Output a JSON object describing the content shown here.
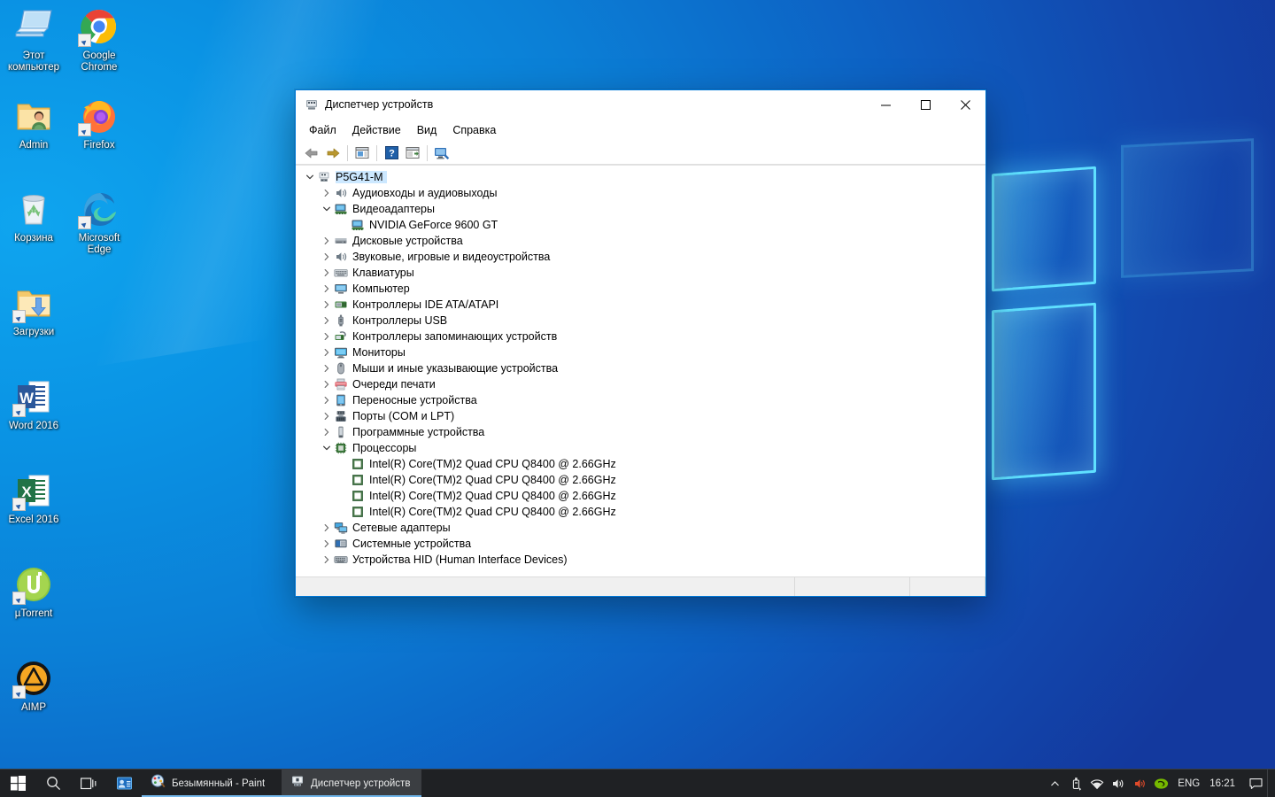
{
  "desktop": {
    "icons": [
      {
        "label": "Этот компьютер",
        "icon": "this-pc-icon",
        "shortcut": false
      },
      {
        "label": "Google Chrome",
        "icon": "chrome-icon",
        "shortcut": true
      },
      {
        "label": "Admin",
        "icon": "user-folder-icon",
        "shortcut": false
      },
      {
        "label": "Firefox",
        "icon": "firefox-icon",
        "shortcut": true
      },
      {
        "label": "Корзина",
        "icon": "recycle-bin-icon",
        "shortcut": false
      },
      {
        "label": "Microsoft Edge",
        "icon": "edge-icon",
        "shortcut": true
      },
      {
        "label": "Загрузки",
        "icon": "downloads-folder-icon",
        "shortcut": true
      },
      {
        "label": "Word 2016",
        "icon": "word-icon",
        "shortcut": true
      },
      {
        "label": "Excel 2016",
        "icon": "excel-icon",
        "shortcut": true
      },
      {
        "label": "µTorrent",
        "icon": "utorrent-icon",
        "shortcut": true
      },
      {
        "label": "AIMP",
        "icon": "aimp-icon",
        "shortcut": true
      }
    ]
  },
  "window": {
    "title": "Диспетчер устройств",
    "title_icon": "device-manager-icon",
    "controls": {
      "minimize": "—",
      "maximize": "☐",
      "close": "✕"
    },
    "menu": [
      {
        "label": "Файл",
        "name": "menu-file"
      },
      {
        "label": "Действие",
        "name": "menu-action"
      },
      {
        "label": "Вид",
        "name": "menu-view"
      },
      {
        "label": "Справка",
        "name": "menu-help"
      }
    ],
    "toolbar": [
      {
        "name": "back-arrow-icon",
        "kind": "back"
      },
      {
        "name": "forward-arrow-icon",
        "kind": "forward"
      },
      {
        "name": "separator",
        "kind": "sep"
      },
      {
        "name": "properties-icon",
        "kind": "props"
      },
      {
        "name": "separator",
        "kind": "sep"
      },
      {
        "name": "help-icon",
        "kind": "help"
      },
      {
        "name": "update-driver-icon",
        "kind": "update"
      },
      {
        "name": "separator",
        "kind": "sep"
      },
      {
        "name": "scan-hardware-icon",
        "kind": "scan"
      }
    ],
    "status": {
      "panel1": "",
      "panel2": "",
      "panel3": ""
    }
  },
  "tree": {
    "root": {
      "label": "P5G41-M",
      "icon": "computer-node-icon",
      "expanded": true,
      "selected": true
    },
    "nodes": [
      {
        "label": "Аудиовходы и аудиовыходы",
        "icon": "audio-icon",
        "expanded": false,
        "depth": 1
      },
      {
        "label": "Видеоадаптеры",
        "icon": "display-adapter-icon",
        "expanded": true,
        "depth": 1
      },
      {
        "label": "NVIDIA GeForce 9600 GT",
        "icon": "display-adapter-icon",
        "leaf": true,
        "depth": 2
      },
      {
        "label": "Дисковые устройства",
        "icon": "disk-drive-icon",
        "expanded": false,
        "depth": 1
      },
      {
        "label": "Звуковые, игровые и видеоустройства",
        "icon": "audio-icon",
        "expanded": false,
        "depth": 1
      },
      {
        "label": "Клавиатуры",
        "icon": "keyboard-icon",
        "expanded": false,
        "depth": 1
      },
      {
        "label": "Компьютер",
        "icon": "computer-icon",
        "expanded": false,
        "depth": 1
      },
      {
        "label": "Контроллеры IDE ATA/ATAPI",
        "icon": "ide-controller-icon",
        "expanded": false,
        "depth": 1
      },
      {
        "label": "Контроллеры USB",
        "icon": "usb-icon",
        "expanded": false,
        "depth": 1
      },
      {
        "label": "Контроллеры запоминающих устройств",
        "icon": "storage-controller-icon",
        "expanded": false,
        "depth": 1
      },
      {
        "label": "Мониторы",
        "icon": "monitor-icon",
        "expanded": false,
        "depth": 1
      },
      {
        "label": "Мыши и иные указывающие устройства",
        "icon": "mouse-icon",
        "expanded": false,
        "depth": 1
      },
      {
        "label": "Очереди печати",
        "icon": "printer-icon",
        "expanded": false,
        "depth": 1
      },
      {
        "label": "Переносные устройства",
        "icon": "portable-device-icon",
        "expanded": false,
        "depth": 1
      },
      {
        "label": "Порты (COM и LPT)",
        "icon": "port-icon",
        "expanded": false,
        "depth": 1
      },
      {
        "label": "Программные устройства",
        "icon": "software-device-icon",
        "expanded": false,
        "depth": 1
      },
      {
        "label": "Процессоры",
        "icon": "processor-icon",
        "expanded": true,
        "depth": 1
      },
      {
        "label": "Intel(R) Core(TM)2 Quad CPU    Q8400  @ 2.66GHz",
        "icon": "cpu-chip-icon",
        "leaf": true,
        "depth": 2
      },
      {
        "label": "Intel(R) Core(TM)2 Quad CPU    Q8400  @ 2.66GHz",
        "icon": "cpu-chip-icon",
        "leaf": true,
        "depth": 2
      },
      {
        "label": "Intel(R) Core(TM)2 Quad CPU    Q8400  @ 2.66GHz",
        "icon": "cpu-chip-icon",
        "leaf": true,
        "depth": 2
      },
      {
        "label": "Intel(R) Core(TM)2 Quad CPU    Q8400  @ 2.66GHz",
        "icon": "cpu-chip-icon",
        "leaf": true,
        "depth": 2
      },
      {
        "label": "Сетевые адаптеры",
        "icon": "network-adapter-icon",
        "expanded": false,
        "depth": 1
      },
      {
        "label": "Системные устройства",
        "icon": "system-device-icon",
        "expanded": false,
        "depth": 1
      },
      {
        "label": "Устройства HID (Human Interface Devices)",
        "icon": "hid-icon",
        "expanded": false,
        "depth": 1
      }
    ]
  },
  "taskbar": {
    "start": "start-button",
    "search": "search-icon",
    "taskview": "task-view-icon",
    "pinned": [
      {
        "name": "contacts-people-icon"
      }
    ],
    "tasks": [
      {
        "label": "Безымянный - Paint",
        "icon": "paint-icon",
        "active": false
      },
      {
        "label": "Диспетчер устройств",
        "icon": "device-manager-icon",
        "active": true
      }
    ],
    "tray": {
      "chevron": "show-hidden-icons-chevron",
      "icons": [
        {
          "name": "usb-eject-icon"
        },
        {
          "name": "wifi-icon"
        },
        {
          "name": "volume-icon"
        },
        {
          "name": "speaker-muted-icon"
        },
        {
          "name": "nvidia-icon"
        }
      ],
      "language": "ENG",
      "clock": "16:21",
      "notifications": "action-center-icon"
    }
  },
  "colors": {
    "accent": "#0078d7",
    "taskbar_bg": "#1f2124",
    "selection": "#cce8ff",
    "desktop_from": "#0fa5ef",
    "desktop_to": "#13399e"
  }
}
